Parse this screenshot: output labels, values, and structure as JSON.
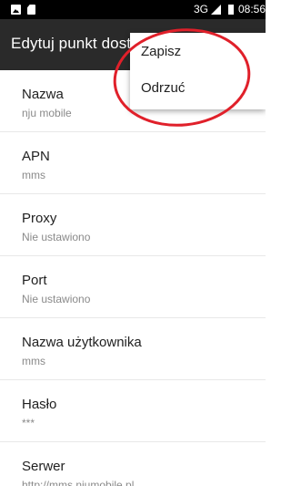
{
  "status_bar": {
    "network": "3G",
    "time": "08:56"
  },
  "app_bar": {
    "title": "Edytuj punkt dostępu"
  },
  "menu": {
    "items": [
      {
        "label": "Zapisz"
      },
      {
        "label": "Odrzuć"
      }
    ]
  },
  "settings": {
    "items": [
      {
        "title": "Nazwa",
        "value": "nju mobile"
      },
      {
        "title": "APN",
        "value": "mms"
      },
      {
        "title": "Proxy",
        "value": "Nie ustawiono"
      },
      {
        "title": "Port",
        "value": "Nie ustawiono"
      },
      {
        "title": "Nazwa użytkownika",
        "value": "mms"
      },
      {
        "title": "Hasło",
        "value": "***"
      },
      {
        "title": "Serwer",
        "value": "http://mms.njumobile.pl"
      }
    ]
  },
  "colors": {
    "status_bar": "#000000",
    "app_bar": "#2a2a2a",
    "annotation": "#e0202a"
  },
  "icons": [
    "image-notification-icon",
    "sd-card-icon",
    "cell-signal-icon",
    "battery-icon"
  ]
}
